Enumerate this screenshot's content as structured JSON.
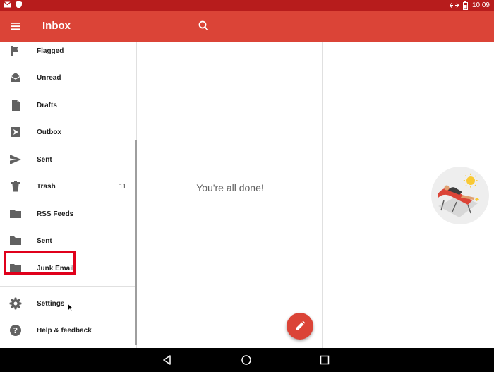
{
  "status_bar": {
    "time": "10:09",
    "left_icons": [
      "mail-notification-icon",
      "shield-icon"
    ],
    "right_icons": [
      "network-arrows-icon",
      "battery-icon"
    ]
  },
  "app_bar": {
    "title": "Inbox",
    "menu_icon": "hamburger-menu-icon",
    "search_icon": "search-icon",
    "color": "#db4437"
  },
  "drawer": {
    "items": [
      {
        "label": "Flagged",
        "icon": "flag-icon",
        "count": ""
      },
      {
        "label": "Unread",
        "icon": "envelope-open-icon",
        "count": ""
      },
      {
        "label": "Drafts",
        "icon": "draft-file-icon",
        "count": ""
      },
      {
        "label": "Outbox",
        "icon": "outbox-icon",
        "count": ""
      },
      {
        "label": "Sent",
        "icon": "send-icon",
        "count": ""
      },
      {
        "label": "Trash",
        "icon": "trash-icon",
        "count": "11"
      },
      {
        "label": "RSS Feeds",
        "icon": "folder-icon",
        "count": ""
      },
      {
        "label": "Sent",
        "icon": "folder-icon",
        "count": ""
      },
      {
        "label": "Junk Email",
        "icon": "folder-icon",
        "count": ""
      }
    ],
    "settings": {
      "label": "Settings",
      "icon": "gear-icon"
    },
    "help": {
      "label": "Help & feedback",
      "icon": "help-icon"
    }
  },
  "list": {
    "empty_message": "You're all done!"
  },
  "fab": {
    "icon": "pencil-icon",
    "color": "#db4437"
  },
  "nav_bar": {
    "buttons": [
      "back-icon",
      "home-icon",
      "recents-icon"
    ]
  },
  "annotation": {
    "highlight_color": "#e0001b"
  }
}
